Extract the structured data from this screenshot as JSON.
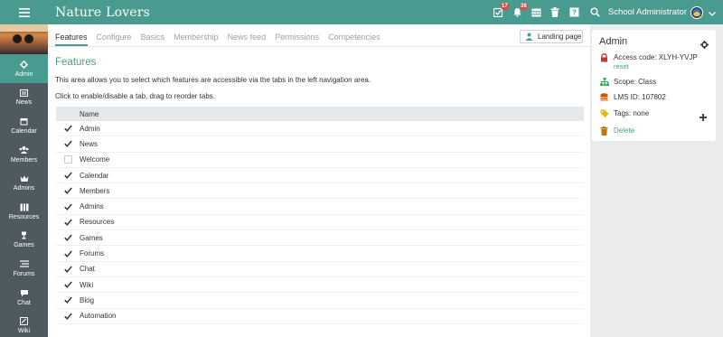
{
  "app": {
    "title": "Nature Lovers"
  },
  "topbar": {
    "badges": {
      "tasks": "17",
      "notifications": "38"
    },
    "user_name": "School Administrator"
  },
  "sidebar": {
    "items": [
      {
        "label": "Admin",
        "icon": "gear-icon",
        "active": true
      },
      {
        "label": "News",
        "icon": "news-icon"
      },
      {
        "label": "Calendar",
        "icon": "calendar-icon"
      },
      {
        "label": "Members",
        "icon": "members-icon"
      },
      {
        "label": "Admins",
        "icon": "crown-icon"
      },
      {
        "label": "Resources",
        "icon": "resources-icon"
      },
      {
        "label": "Games",
        "icon": "trophy-icon"
      },
      {
        "label": "Forums",
        "icon": "forums-icon"
      },
      {
        "label": "Chat",
        "icon": "chat-icon"
      },
      {
        "label": "Wiki",
        "icon": "wiki-icon"
      }
    ]
  },
  "tabs": [
    "Features",
    "Configure",
    "Basics",
    "Membership",
    "News feed",
    "Permissions",
    "Competencies"
  ],
  "landing_button": "Landing page",
  "features": {
    "title": "Features",
    "desc1": "This area allows you to select which features are accessible via the tabs in the left navigation area.",
    "desc2": "Click to enable/disable a tab, drag to reorder tabs.",
    "column_header": "Name",
    "rows": [
      {
        "name": "Admin",
        "checked": true
      },
      {
        "name": "News",
        "checked": true
      },
      {
        "name": "Welcome",
        "checked": false
      },
      {
        "name": "Calendar",
        "checked": true
      },
      {
        "name": "Members",
        "checked": true
      },
      {
        "name": "Admins",
        "checked": true
      },
      {
        "name": "Resources",
        "checked": true
      },
      {
        "name": "Games",
        "checked": true
      },
      {
        "name": "Forums",
        "checked": true
      },
      {
        "name": "Chat",
        "checked": true
      },
      {
        "name": "Wiki",
        "checked": true
      },
      {
        "name": "Blog",
        "checked": true
      },
      {
        "name": "Automation",
        "checked": true
      }
    ]
  },
  "card": {
    "title": "Admin",
    "access_code": "Access code: XLYH-YVJP",
    "reset": "reset",
    "scope": "Scope: Class",
    "lms_id": "LMS ID: 107802",
    "tags": "Tags: none",
    "delete": "Delete"
  },
  "colors": {
    "accent": "#4a9b8f",
    "sidebar_bg": "#4f5a60",
    "badge": "#e14747",
    "lock": "#c0392b",
    "scope": "#27ae60",
    "lms": "#d35400",
    "tag": "#e6b800",
    "trash": "#b9770e"
  }
}
